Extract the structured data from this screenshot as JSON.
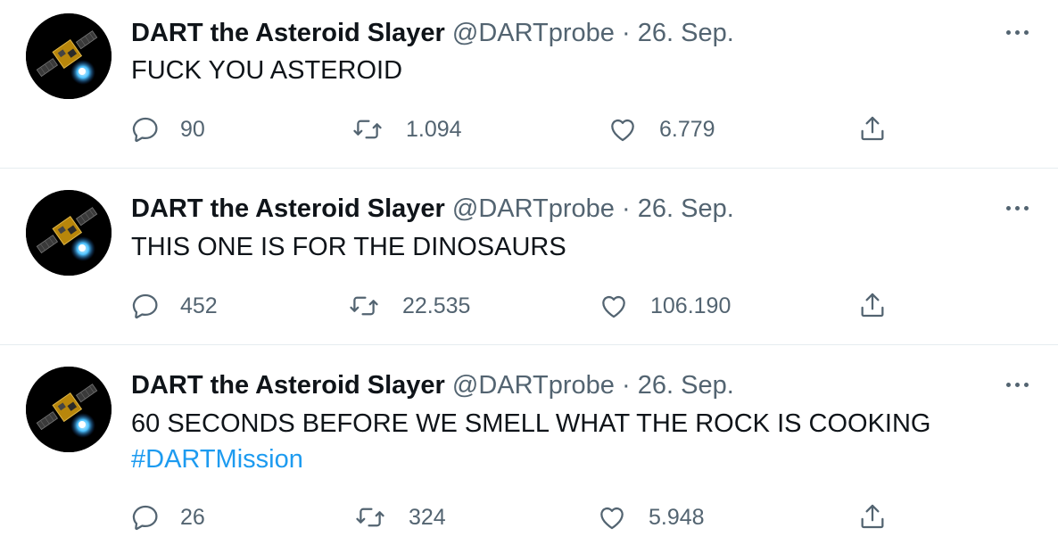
{
  "tweets": [
    {
      "author_name": "DART the Asteroid Slayer",
      "handle": "@DARTprobe",
      "separator": "·",
      "date": "26. Sep.",
      "text": "FUCK YOU ASTEROID",
      "hashtag": "",
      "replies": "90",
      "retweets": "1.094",
      "likes": "6.779"
    },
    {
      "author_name": "DART the Asteroid Slayer",
      "handle": "@DARTprobe",
      "separator": "·",
      "date": "26. Sep.",
      "text": "THIS ONE IS FOR THE DINOSAURS",
      "hashtag": "",
      "replies": "452",
      "retweets": "22.535",
      "likes": "106.190"
    },
    {
      "author_name": "DART the Asteroid Slayer",
      "handle": "@DARTprobe",
      "separator": "·",
      "date": "26. Sep.",
      "text": "60 SECONDS BEFORE WE SMELL WHAT THE ROCK IS COOKING",
      "hashtag": "#DARTMission",
      "replies": "26",
      "retweets": "324",
      "likes": "5.948"
    }
  ],
  "icons": {
    "reply": "reply-icon",
    "retweet": "retweet-icon",
    "like": "like-icon",
    "share": "share-icon",
    "more": "more-icon"
  },
  "colors": {
    "text": "#0f1419",
    "secondary": "#536471",
    "link": "#1d9bf0",
    "divider": "#e6ecf0"
  }
}
